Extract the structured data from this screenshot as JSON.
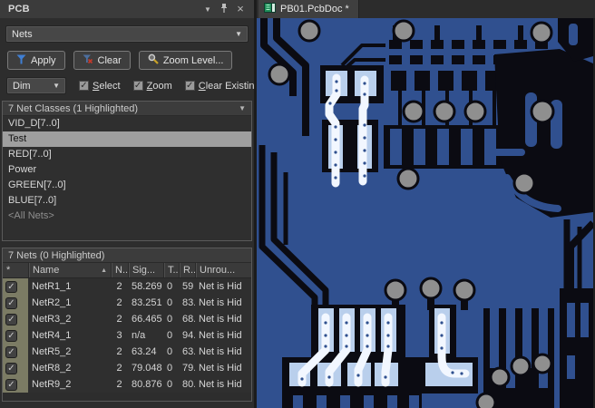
{
  "icons": {
    "dropdown": "▼",
    "close": "×",
    "check": "✓",
    "sort_asc": "▲"
  },
  "colors": {
    "panel-bg": "#2d2d2d",
    "titlebar-bg": "#3b3b3b",
    "control-bg": "#474747",
    "section-bg": "#3c3c3c",
    "box-border": "#5a5a5a",
    "list-bg": "#2f2f2f",
    "selected-bg": "#9f9f9f",
    "selected-text": "#141414",
    "text": "#d5d5d5",
    "muted-text": "#8f8f8f",
    "check-col-bg": "#7b7b64",
    "tabbar-bg": "#2c2c2c",
    "tab-bg": "#3f3f3f",
    "pcb-blue": "#30508f",
    "pcb-black": "#0b0b12",
    "via-gray": "#8f8f8f",
    "pad-light": "#b9cfec",
    "hl-white": "#f2f7ff",
    "apply-funnel": "#3f7fd4",
    "clear-x": "#c0392b",
    "magnifier-handle": "#c9a227"
  },
  "panel": {
    "title": "PCB",
    "mode_select": {
      "value": "Nets"
    },
    "toolbar": {
      "apply": "Apply",
      "clear": "Clear",
      "zoom_level": "Zoom Level..."
    },
    "dim_row": {
      "dim": "Dim",
      "checkboxes": [
        {
          "label": "Select",
          "checked": true
        },
        {
          "label": "Zoom",
          "checked": true
        },
        {
          "label": "Clear Existing",
          "checked": true
        }
      ]
    },
    "classes": {
      "header": "7 Net Classes (1 Highlighted)",
      "items": [
        {
          "label": "VID_D[7..0]"
        },
        {
          "label": "Test",
          "selected": true
        },
        {
          "label": "RED[7..0]"
        },
        {
          "label": "Power"
        },
        {
          "label": "GREEN[7..0]"
        },
        {
          "label": "BLUE[7..0]"
        },
        {
          "label": "<All Nets>",
          "muted": true
        }
      ]
    },
    "nets": {
      "header": "7 Nets (0 Highlighted)",
      "columns": [
        "*",
        "Name",
        "N..",
        "Sig...",
        "T...",
        "R...",
        "Unrou..."
      ],
      "rows": [
        {
          "checked": true,
          "name": "NetR1_1",
          "n": "2",
          "sig": "58.269",
          "t": "0",
          "r": "59",
          "unroute": "Net is Hid"
        },
        {
          "checked": true,
          "name": "NetR2_1",
          "n": "2",
          "sig": "83.251",
          "t": "0",
          "r": "83.",
          "unroute": "Net is Hid"
        },
        {
          "checked": true,
          "name": "NetR3_2",
          "n": "2",
          "sig": "66.465",
          "t": "0",
          "r": "68.",
          "unroute": "Net is Hid"
        },
        {
          "checked": true,
          "name": "NetR4_1",
          "n": "3",
          "sig": "n/a",
          "t": "0",
          "r": "94.",
          "unroute": "Net is Hid"
        },
        {
          "checked": true,
          "name": "NetR5_2",
          "n": "2",
          "sig": "63.24",
          "t": "0",
          "r": "63.",
          "unroute": "Net is Hid"
        },
        {
          "checked": true,
          "name": "NetR8_2",
          "n": "2",
          "sig": "79.048",
          "t": "0",
          "r": "79.",
          "unroute": "Net is Hid"
        },
        {
          "checked": true,
          "name": "NetR9_2",
          "n": "2",
          "sig": "80.876",
          "t": "0",
          "r": "80.",
          "unroute": "Net is Hid"
        }
      ]
    }
  },
  "tab": {
    "label": "PB01.PcbDoc *"
  }
}
